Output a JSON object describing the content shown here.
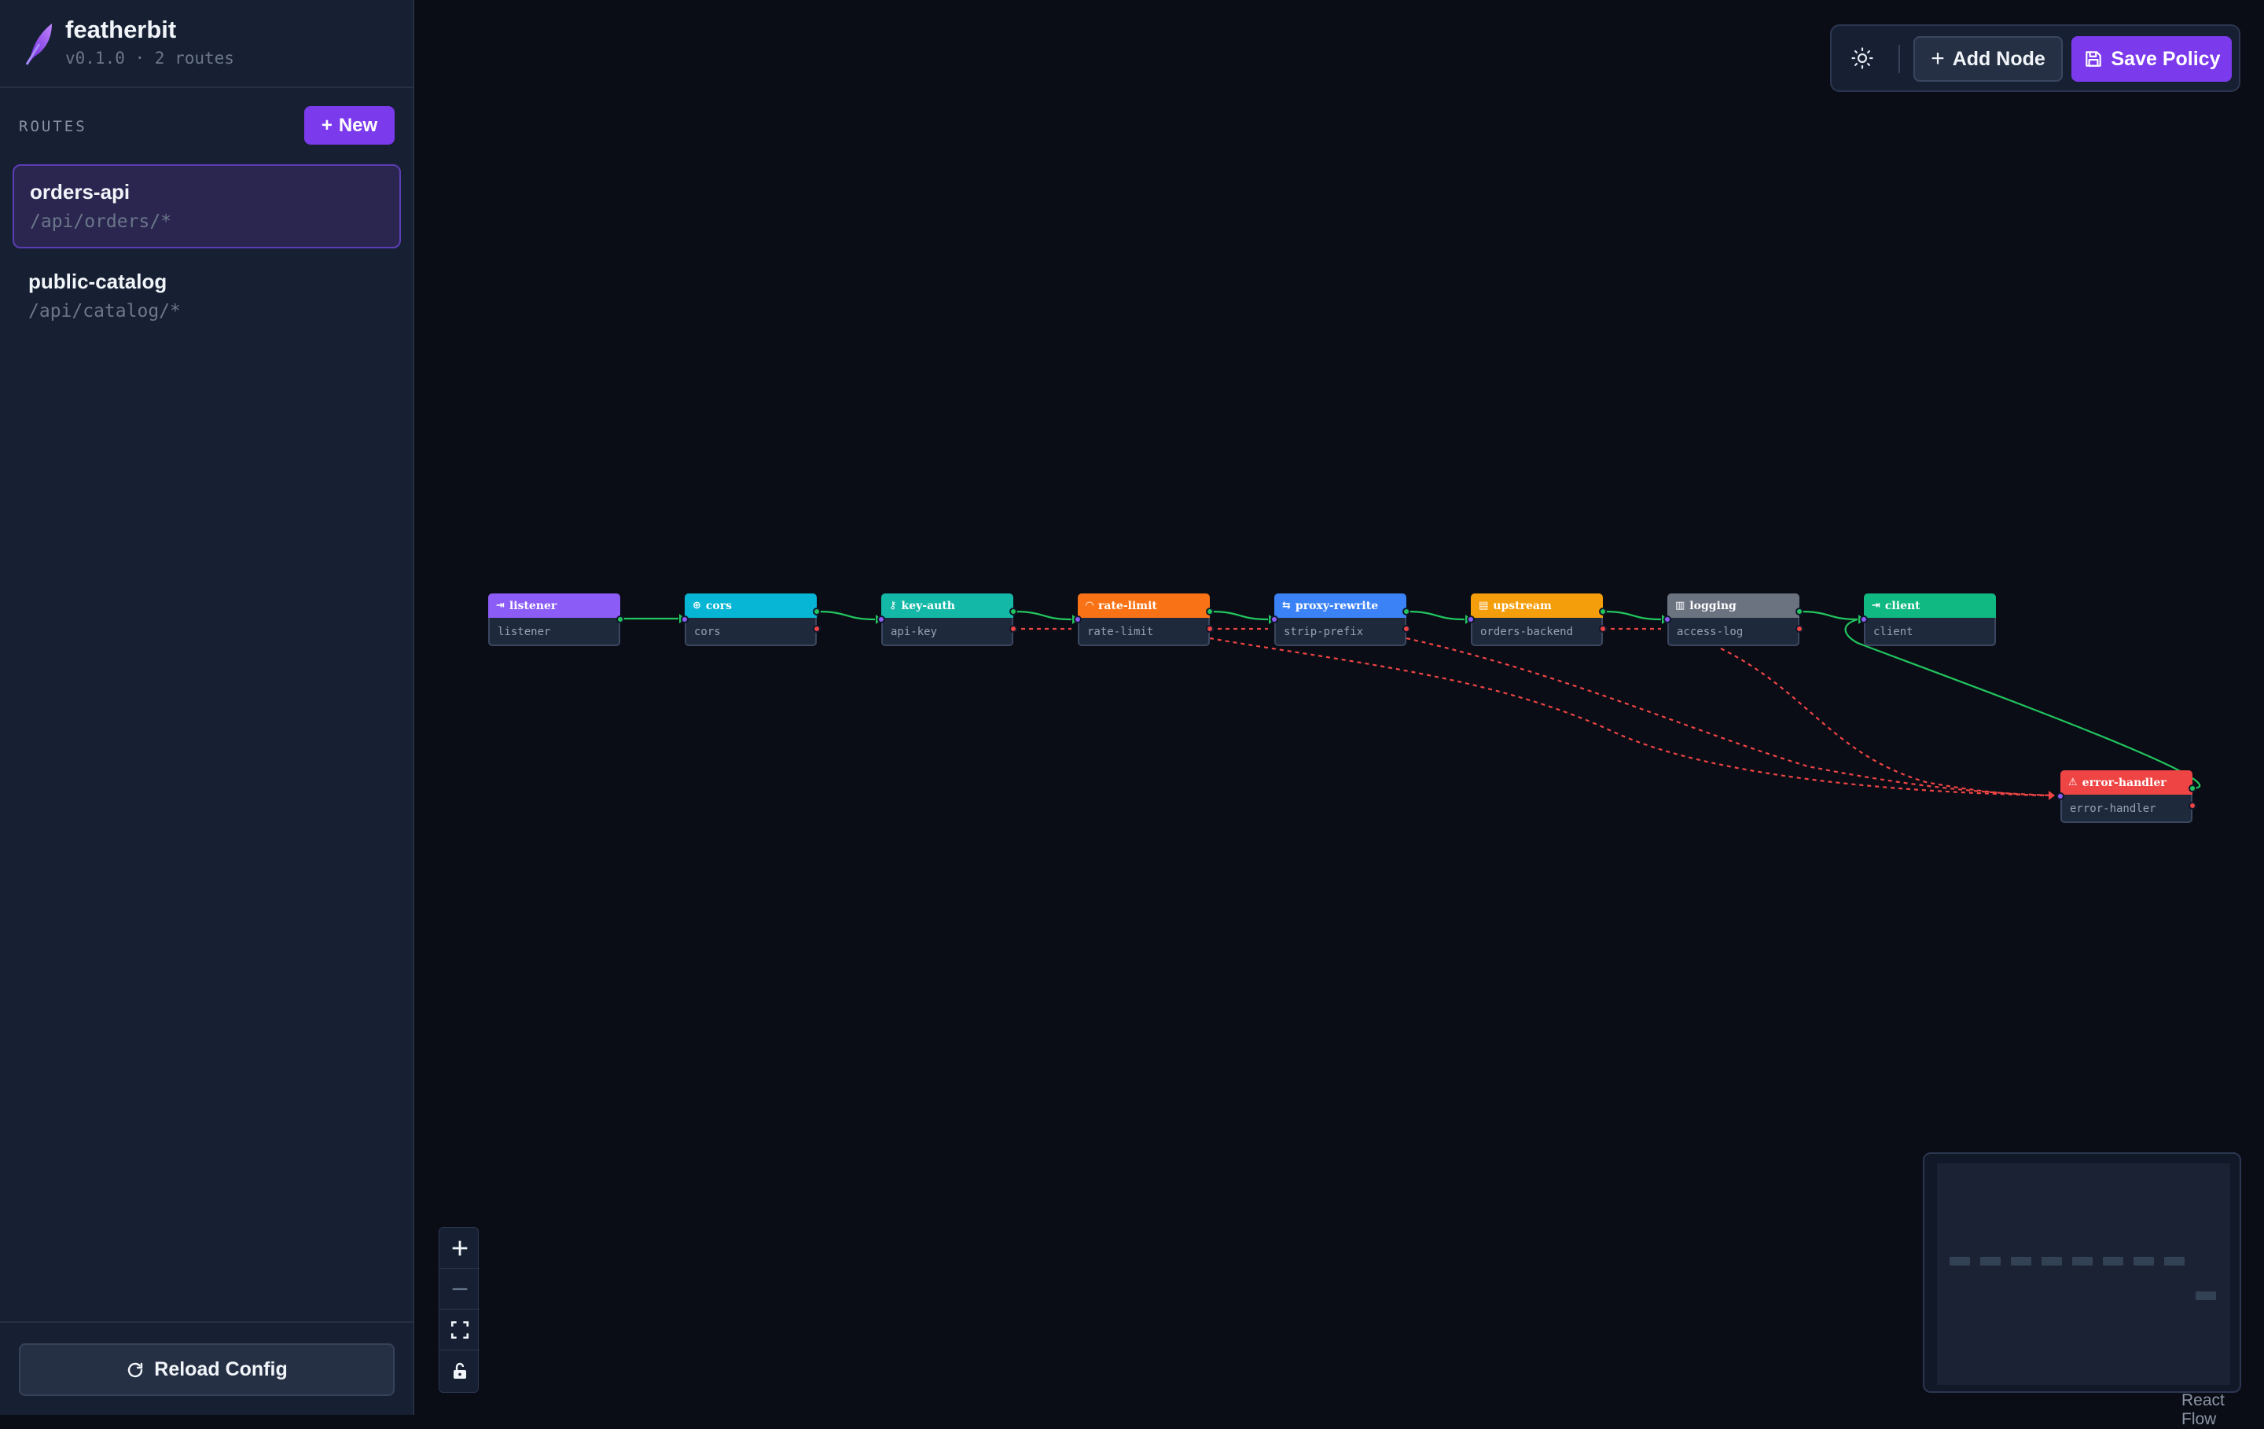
{
  "app": {
    "name": "featherbit",
    "meta": "v0.1.0 · 2 routes"
  },
  "sidebar": {
    "section_label": "ROUTES",
    "new_button": "New",
    "routes": [
      {
        "name": "orders-api",
        "path": "/api/orders/*",
        "active": true
      },
      {
        "name": "public-catalog",
        "path": "/api/catalog/*",
        "active": false
      }
    ],
    "reload_button": "Reload Config"
  },
  "toolbar": {
    "theme_icon": "sun-icon",
    "add_node": "Add Node",
    "save_policy": "Save Policy"
  },
  "nodes": [
    {
      "type": "listener",
      "label": "listener",
      "icon": "log-in-icon",
      "color": "#8b5cf6"
    },
    {
      "type": "cors",
      "label": "cors",
      "icon": "globe-icon",
      "color": "#06b6d4"
    },
    {
      "type": "key-auth",
      "label": "api-key",
      "icon": "key-icon",
      "color": "#14b8a6"
    },
    {
      "type": "rate-limit",
      "label": "rate-limit",
      "icon": "gauge-icon",
      "color": "#f97316"
    },
    {
      "type": "proxy-rewrite",
      "label": "strip-prefix",
      "icon": "arrows-icon",
      "color": "#3b82f6"
    },
    {
      "type": "upstream",
      "label": "orders-backend",
      "icon": "server-icon",
      "color": "#f59e0b"
    },
    {
      "type": "logging",
      "label": "access-log",
      "icon": "scroll-icon",
      "color": "#6b7280"
    },
    {
      "type": "client",
      "label": "client",
      "icon": "log-out-icon",
      "color": "#10b981"
    },
    {
      "type": "error-handler",
      "label": "error-handler",
      "icon": "alert-icon",
      "color": "#ef4444"
    }
  ],
  "edge_colors": {
    "success": "#22c55e",
    "error": "#ef4444"
  },
  "attribution": "React Flow"
}
